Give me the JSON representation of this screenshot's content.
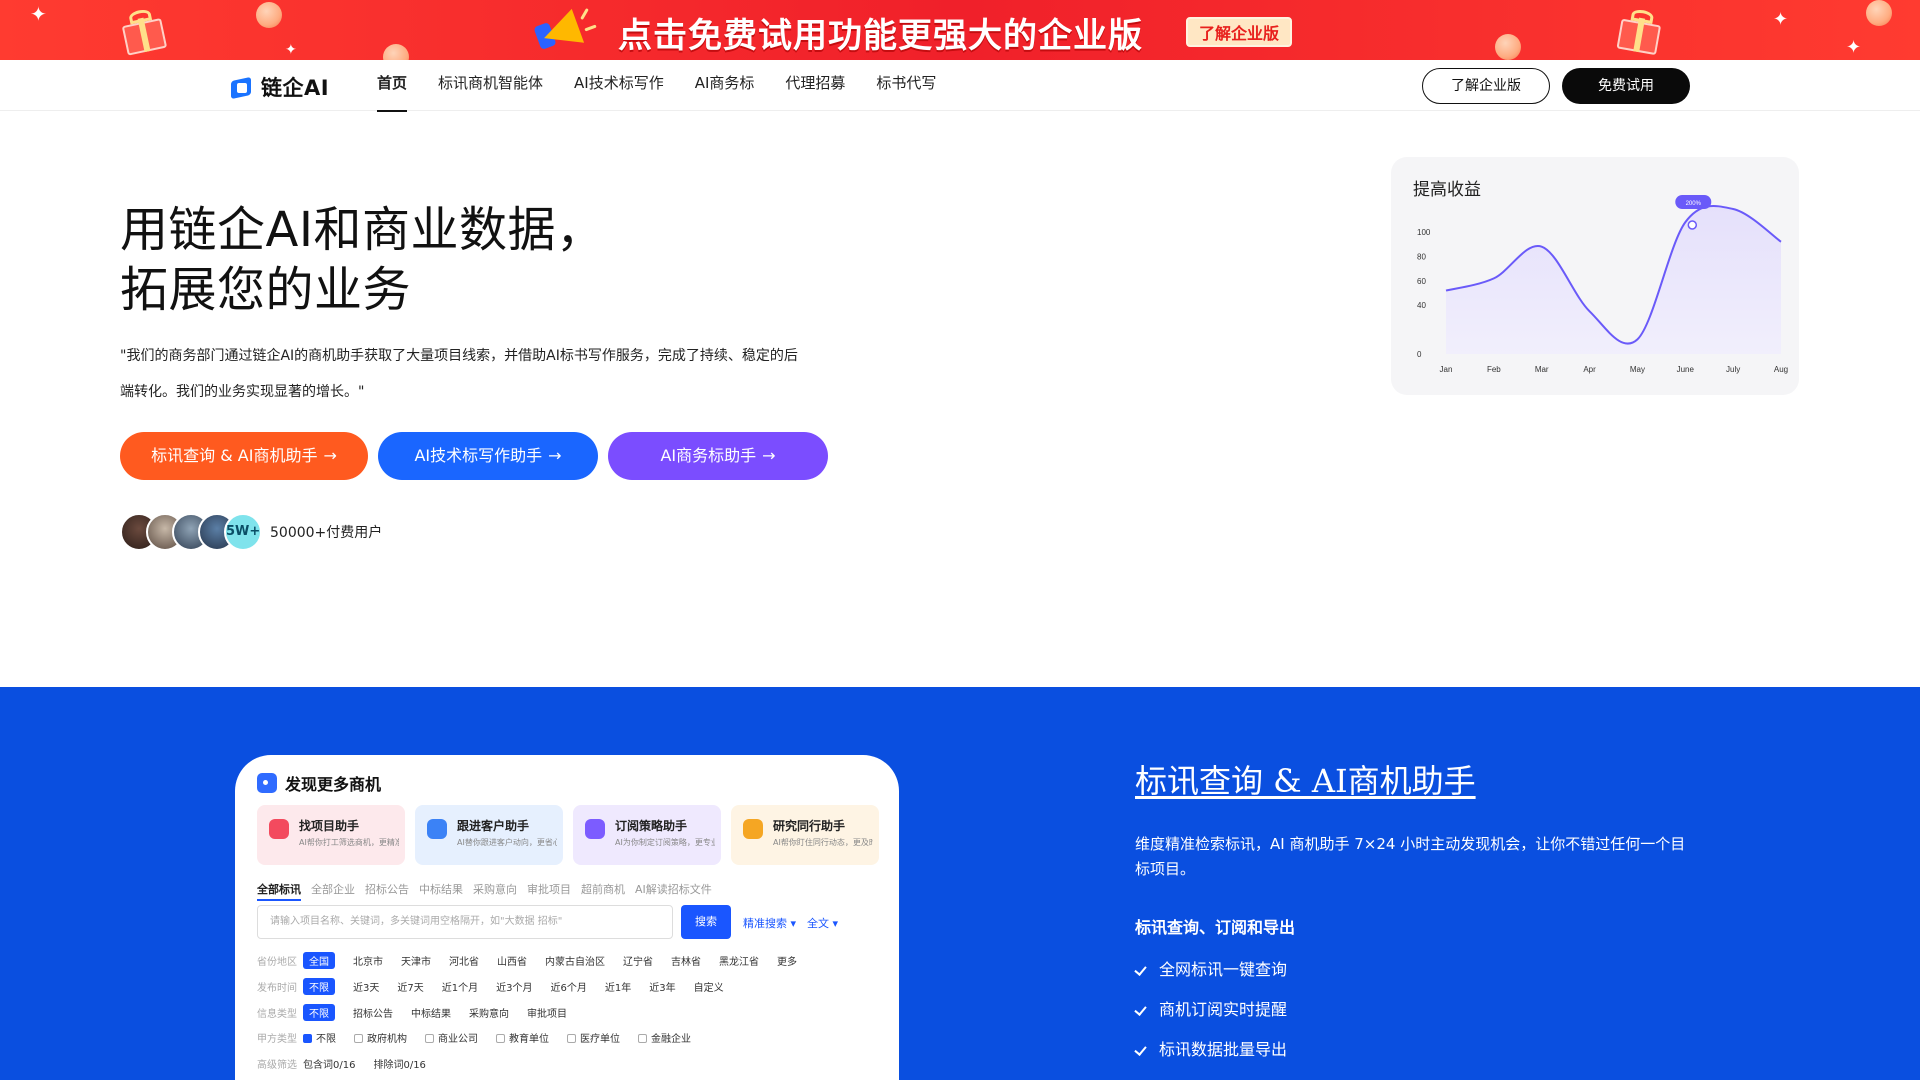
{
  "promo": {
    "text": "点击免费试用功能更强大的企业版",
    "button": "了解企业版"
  },
  "nav": {
    "logo": "链企AI",
    "links": [
      "首页",
      "标讯商机智能体",
      "AI技术标写作",
      "AI商务标",
      "代理招募",
      "标书代写"
    ],
    "learn_enterprise": "了解企业版",
    "free_trial": "免费试用"
  },
  "hero": {
    "title_line1": "用链企AI和商业数据，",
    "title_line2": "拓展您的业务",
    "quote": "\"我们的商务部门通过链企AI的商机助手获取了大量项目线索，并借助AI标书写作服务，完成了持续、稳定的后端转化。我们的业务实现显著的增长。\"",
    "cta1": "标讯查询 & AI商机助手",
    "cta2": "AI技术标写作助手",
    "cta3": "AI商务标助手",
    "avatar_badge": "5W+",
    "user_count": "50000+付费用户"
  },
  "chart_data": {
    "type": "area",
    "title": "提高收益",
    "categories": [
      "Jan",
      "Feb",
      "Mar",
      "Apr",
      "May",
      "June",
      "July",
      "Aug"
    ],
    "values": [
      52,
      62,
      88,
      35,
      12,
      108,
      128,
      92
    ],
    "ylim": [
      0,
      100
    ],
    "yticks": [
      0,
      20,
      40,
      60,
      80,
      100
    ],
    "ytick_labels": [
      "0",
      "40",
      "60",
      "80",
      "100"
    ],
    "highlight": {
      "category": "June",
      "label": "200%"
    },
    "color": "#6a5af9",
    "fill": "#e5e0fb"
  },
  "panel": {
    "title": "发现更多商机",
    "tiles": [
      {
        "name": "找项目助手",
        "desc": "AI帮你打工筛选商机，更精准"
      },
      {
        "name": "跟进客户助手",
        "desc": "AI替你跟进客户动向，更省心"
      },
      {
        "name": "订阅策略助手",
        "desc": "AI为你制定订阅策略，更专业"
      },
      {
        "name": "研究同行助手",
        "desc": "AI帮你盯住同行动态，更及时"
      }
    ],
    "tabs": [
      "全部标讯",
      "全部企业",
      "招标公告",
      "中标结果",
      "采购意向",
      "审批项目",
      "超前商机",
      "AI解读招标文件"
    ],
    "search_placeholder": "请输入项目名称、关键词，多关键词用空格隔开，如\"大数据 招标\"",
    "search_button": "搜索",
    "precise_search": "精准搜索",
    "full_text": "全文",
    "filters": {
      "region_label": "省份地区",
      "regions": [
        "全国",
        "北京市",
        "天津市",
        "河北省",
        "山西省",
        "内蒙古自治区",
        "辽宁省",
        "吉林省",
        "黑龙江省",
        "更多"
      ],
      "time_label": "发布时间",
      "times": [
        "不限",
        "近3天",
        "近7天",
        "近1个月",
        "近3个月",
        "近6个月",
        "近1年",
        "近3年",
        "自定义"
      ],
      "type_label": "信息类型",
      "types": [
        "不限",
        "招标公告",
        "中标结果",
        "采购意向",
        "审批项目"
      ],
      "party_label": "甲方类型",
      "parties": [
        "不限",
        "政府机构",
        "商业公司",
        "教育单位",
        "医疗单位",
        "金融企业"
      ],
      "advanced_label": "高级筛选",
      "include": "包含词0/16",
      "exclude": "排除词0/16"
    }
  },
  "feature": {
    "title": "标讯查询 & AI商机助手",
    "desc": "维度精准检索标讯，AI 商机助手 7×24 小时主动发现机会，让你不错过任何一个目标项目。",
    "subtitle": "标讯查询、订阅和导出",
    "items": [
      "全网标讯一键查询",
      "商机订阅实时提醒",
      "标讯数据批量导出"
    ]
  }
}
